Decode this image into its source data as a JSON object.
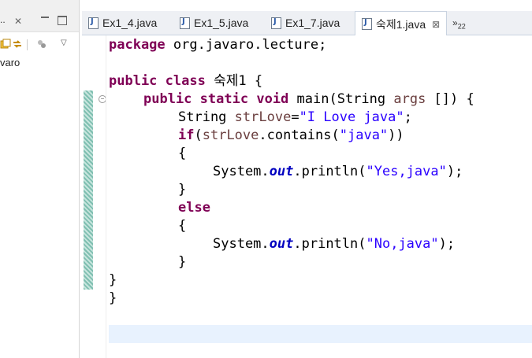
{
  "left_panel": {
    "title_fragment": "..",
    "tree_item": "varo"
  },
  "tabs": [
    {
      "label": "Ex1_4.java"
    },
    {
      "label": "Ex1_5.java"
    },
    {
      "label": "Ex1_7.java"
    },
    {
      "label": "숙제1.java",
      "active": true
    }
  ],
  "overflow": {
    "label": "»",
    "count": "22"
  },
  "close_glyph": "⊠",
  "code": {
    "l1_kw": "package",
    "l1_rest": " org.javaro.lecture;",
    "l3_kw1": "public",
    "l3_kw2": "class",
    "l3_rest": " 숙제1 {",
    "l4_kw1": "public",
    "l4_kw2": "static",
    "l4_kw3": "void",
    "l4_a": " main(String ",
    "l4_var": "args",
    "l4_b": " []) {",
    "l5_a": "String ",
    "l5_var": "strLove",
    "l5_eq": "=",
    "l5_str": "\"I Love java\"",
    "l5_end": ";",
    "l6_kw": "if",
    "l6_a": "(",
    "l6_var": "strLove",
    "l6_b": ".contains(",
    "l6_str": "\"java\"",
    "l6_c": "))",
    "open_brace": "{",
    "close_brace": "}",
    "sys": "System.",
    "out": "out",
    "println": ".println(",
    "yes_str": "\"Yes,java\"",
    "no_str": "\"No,java\"",
    "stmt_end": ");",
    "else_kw": "else"
  }
}
